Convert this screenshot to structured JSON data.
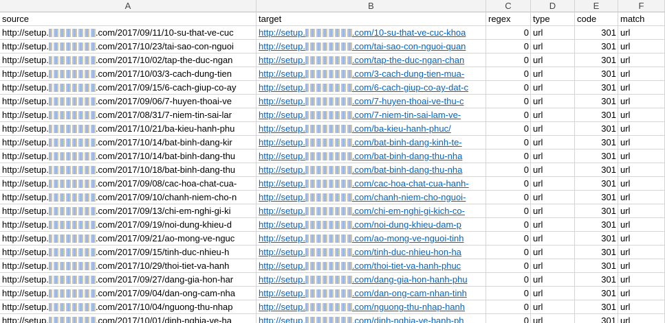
{
  "columns": [
    "A",
    "B",
    "C",
    "D",
    "E",
    "F"
  ],
  "header_row": [
    "source",
    "target",
    "regex",
    "type",
    "code",
    "match"
  ],
  "rows": [
    {
      "src_prefix": "http://setup.",
      "src_path": ".com/2017/09/11/10-su-that-ve-cuc",
      "tgt_prefix": "http://setup.",
      "tgt_path": ".com/10-su-that-ve-cuc-khoa",
      "regex": "0",
      "type": "url",
      "code": "301",
      "match": "url"
    },
    {
      "src_prefix": "http://setup.",
      "src_path": ".com/2017/10/23/tai-sao-con-nguoi",
      "tgt_prefix": "http://setup.",
      "tgt_path": ".com/tai-sao-con-nguoi-quan",
      "regex": "0",
      "type": "url",
      "code": "301",
      "match": "url"
    },
    {
      "src_prefix": "http://setup.",
      "src_path": ".com/2017/10/02/tap-the-duc-ngan",
      "tgt_prefix": "http://setup.",
      "tgt_path": ".com/tap-the-duc-ngan-chan",
      "regex": "0",
      "type": "url",
      "code": "301",
      "match": "url"
    },
    {
      "src_prefix": "http://setup.",
      "src_path": ".com/2017/10/03/3-cach-dung-tien",
      "tgt_prefix": "http://setup.",
      "tgt_path": ".com/3-cach-dung-tien-mua-",
      "regex": "0",
      "type": "url",
      "code": "301",
      "match": "url"
    },
    {
      "src_prefix": "http://setup.",
      "src_path": ".com/2017/09/15/6-cach-giup-co-ay",
      "tgt_prefix": "http://setup.",
      "tgt_path": ".com/6-cach-giup-co-ay-dat-c",
      "regex": "0",
      "type": "url",
      "code": "301",
      "match": "url"
    },
    {
      "src_prefix": "http://setup.",
      "src_path": ".com/2017/09/06/7-huyen-thoai-ve",
      "tgt_prefix": "http://setup.",
      "tgt_path": ".com/7-huyen-thoai-ve-thu-c",
      "regex": "0",
      "type": "url",
      "code": "301",
      "match": "url"
    },
    {
      "src_prefix": "http://setup.",
      "src_path": ".com/2017/08/31/7-niem-tin-sai-lar",
      "tgt_prefix": "http://setup.",
      "tgt_path": ".com/7-niem-tin-sai-lam-ve-",
      "regex": "0",
      "type": "url",
      "code": "301",
      "match": "url"
    },
    {
      "src_prefix": "http://setup.",
      "src_path": ".com/2017/10/21/ba-kieu-hanh-phu",
      "tgt_prefix": "http://setup.",
      "tgt_path": ".com/ba-kieu-hanh-phuc/",
      "regex": "0",
      "type": "url",
      "code": "301",
      "match": "url"
    },
    {
      "src_prefix": "http://setup.",
      "src_path": ".com/2017/10/14/bat-binh-dang-kir",
      "tgt_prefix": "http://setup.",
      "tgt_path": ".com/bat-binh-dang-kinh-te-",
      "regex": "0",
      "type": "url",
      "code": "301",
      "match": "url"
    },
    {
      "src_prefix": "http://setup.",
      "src_path": ".com/2017/10/14/bat-binh-dang-thu",
      "tgt_prefix": "http://setup.",
      "tgt_path": ".com/bat-binh-dang-thu-nha",
      "regex": "0",
      "type": "url",
      "code": "301",
      "match": "url"
    },
    {
      "src_prefix": "http://setup.",
      "src_path": ".com/2017/10/18/bat-binh-dang-thu",
      "tgt_prefix": "http://setup.",
      "tgt_path": ".com/bat-binh-dang-thu-nha",
      "regex": "0",
      "type": "url",
      "code": "301",
      "match": "url"
    },
    {
      "src_prefix": "http://setup.",
      "src_path": ".com/2017/09/08/cac-hoa-chat-cua-",
      "tgt_prefix": "http://setup.",
      "tgt_path": ".com/cac-hoa-chat-cua-hanh-",
      "regex": "0",
      "type": "url",
      "code": "301",
      "match": "url"
    },
    {
      "src_prefix": "http://setup.",
      "src_path": ".com/2017/09/10/chanh-niem-cho-n",
      "tgt_prefix": "http://setup.",
      "tgt_path": ".com/chanh-niem-cho-nguoi-",
      "regex": "0",
      "type": "url",
      "code": "301",
      "match": "url"
    },
    {
      "src_prefix": "http://setup.",
      "src_path": ".com/2017/09/13/chi-em-nghi-gi-ki",
      "tgt_prefix": "http://setup.",
      "tgt_path": ".com/chi-em-nghi-gi-kich-co-",
      "regex": "0",
      "type": "url",
      "code": "301",
      "match": "url"
    },
    {
      "src_prefix": "http://setup.",
      "src_path": ".com/2017/09/19/noi-dung-khieu-d",
      "tgt_prefix": "http://setup.",
      "tgt_path": ".com/noi-dung-khieu-dam-p",
      "regex": "0",
      "type": "url",
      "code": "301",
      "match": "url"
    },
    {
      "src_prefix": "http://setup.",
      "src_path": ".com/2017/09/21/ao-mong-ve-nguc",
      "tgt_prefix": "http://setup.",
      "tgt_path": ".com/ao-mong-ve-nguoi-tinh",
      "regex": "0",
      "type": "url",
      "code": "301",
      "match": "url"
    },
    {
      "src_prefix": "http://setup.",
      "src_path": ".com/2017/09/15/tinh-duc-nhieu-h",
      "tgt_prefix": "http://setup.",
      "tgt_path": ".com/tinh-duc-nhieu-hon-ha",
      "regex": "0",
      "type": "url",
      "code": "301",
      "match": "url"
    },
    {
      "src_prefix": "http://setup.",
      "src_path": ".com/2017/10/29/thoi-tiet-va-hanh",
      "tgt_prefix": "http://setup.",
      "tgt_path": ".com/thoi-tiet-va-hanh-phuc",
      "regex": "0",
      "type": "url",
      "code": "301",
      "match": "url"
    },
    {
      "src_prefix": "http://setup.",
      "src_path": ".com/2017/09/27/dang-gia-hon-har",
      "tgt_prefix": "http://setup.",
      "tgt_path": ".com/dang-gia-hon-hanh-phu",
      "regex": "0",
      "type": "url",
      "code": "301",
      "match": "url"
    },
    {
      "src_prefix": "http://setup.",
      "src_path": ".com/2017/09/04/dan-ong-cam-nha",
      "tgt_prefix": "http://setup.",
      "tgt_path": ".com/dan-ong-cam-nhan-tinh",
      "regex": "0",
      "type": "url",
      "code": "301",
      "match": "url"
    },
    {
      "src_prefix": "http://setup.",
      "src_path": ".com/2017/10/04/nguong-thu-nhap",
      "tgt_prefix": "http://setup.",
      "tgt_path": ".com/nguong-thu-nhap-hanh",
      "regex": "0",
      "type": "url",
      "code": "301",
      "match": "url"
    },
    {
      "src_prefix": "http://setup.",
      "src_path": ".com/2017/10/01/dinh-nghia-ve-ha",
      "tgt_prefix": "http://setup.",
      "tgt_path": ".com/dinh-nghia-ve-hanh-ph",
      "regex": "0",
      "type": "url",
      "code": "301",
      "match": "url"
    }
  ]
}
